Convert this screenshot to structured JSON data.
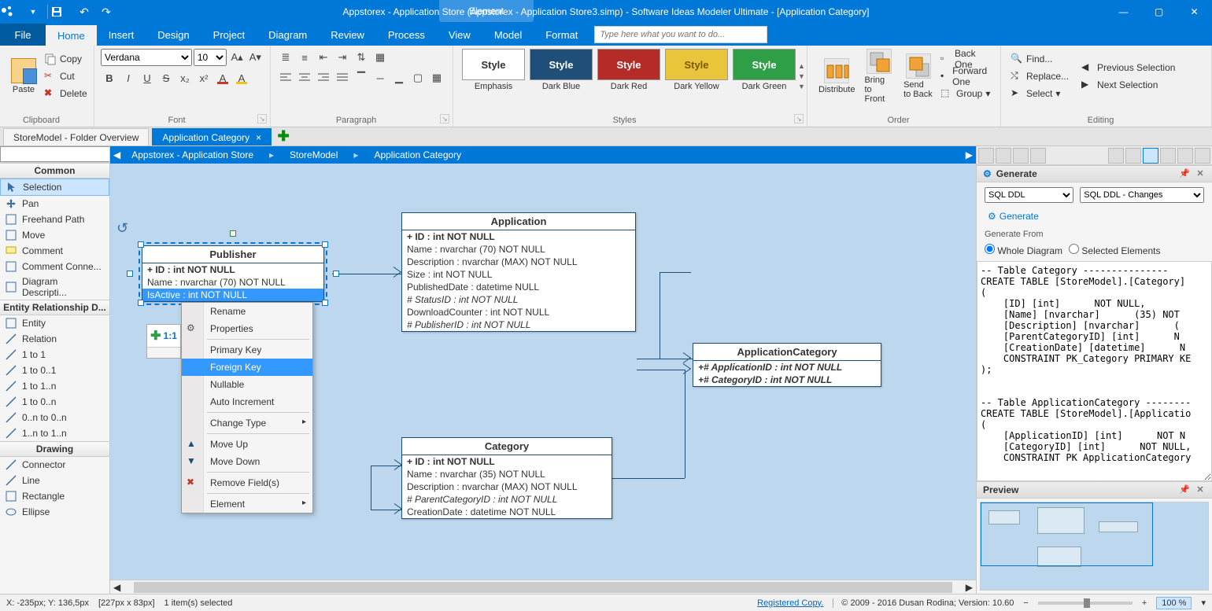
{
  "titlebar": {
    "element_tag": "Element",
    "title": "Appstorex - Application Store (Appstorex - Application Store3.simp)  - Software Ideas Modeler Ultimate - [Application Category]"
  },
  "menubar": {
    "file": "File",
    "tabs": [
      "Home",
      "Insert",
      "Design",
      "Project",
      "Diagram",
      "Review",
      "Process",
      "View",
      "Model",
      "Format"
    ],
    "active": 0,
    "search_placeholder": "Type here what you want to do..."
  },
  "ribbon": {
    "clipboard": {
      "label": "Clipboard",
      "paste": "Paste",
      "copy": "Copy",
      "cut": "Cut",
      "delete": "Delete"
    },
    "font": {
      "label": "Font",
      "name": "Verdana",
      "size": "10"
    },
    "paragraph": {
      "label": "Paragraph"
    },
    "styles": {
      "label": "Styles",
      "items": [
        {
          "text": "Style",
          "bg": "#ffffff",
          "fg": "#333333",
          "sub": "Emphasis"
        },
        {
          "text": "Style",
          "bg": "#1f4e79",
          "fg": "#ffffff",
          "sub": "Dark Blue"
        },
        {
          "text": "Style",
          "bg": "#b52b27",
          "fg": "#ffffff",
          "sub": "Dark Red"
        },
        {
          "text": "Style",
          "bg": "#e8c53a",
          "fg": "#7a5900",
          "sub": "Dark Yellow"
        },
        {
          "text": "Style",
          "bg": "#2e9e47",
          "fg": "#ffffff",
          "sub": "Dark Green"
        }
      ]
    },
    "order": {
      "label": "Order",
      "distribute": "Distribute",
      "bring_front": "Bring to Front",
      "send_back": "Send to Back",
      "back_one": "Back One",
      "forward_one": "Forward One",
      "group": "Group"
    },
    "editing": {
      "label": "Editing",
      "find": "Find...",
      "replace": "Replace...",
      "select": "Select",
      "prev_sel": "Previous Selection",
      "next_sel": "Next Selection"
    }
  },
  "doctabs": {
    "tabs": [
      {
        "label": "StoreModel - Folder Overview",
        "active": false
      },
      {
        "label": "Application Category",
        "active": true
      }
    ]
  },
  "toolbox": {
    "categories": [
      {
        "title": "Common",
        "tools": [
          {
            "label": "Selection",
            "sel": true,
            "icon": "cursor"
          },
          {
            "label": "Pan",
            "icon": "pan"
          },
          {
            "label": "Freehand Path",
            "icon": "path"
          },
          {
            "label": "Move",
            "icon": "move"
          },
          {
            "label": "Comment",
            "icon": "comment"
          },
          {
            "label": "Comment Conne...",
            "icon": "comment-conn"
          },
          {
            "label": "Diagram Descripti...",
            "icon": "desc"
          }
        ]
      },
      {
        "title": "Entity Relationship D...",
        "tools": [
          {
            "label": "Entity",
            "icon": "entity"
          },
          {
            "label": "Relation",
            "icon": "relation"
          },
          {
            "label": "1 to 1",
            "icon": "rel"
          },
          {
            "label": "1 to 0..1",
            "icon": "rel"
          },
          {
            "label": "1 to 1..n",
            "icon": "rel"
          },
          {
            "label": "1 to 0..n",
            "icon": "rel"
          },
          {
            "label": "0..n to 0..n",
            "icon": "rel"
          },
          {
            "label": "1..n to 1..n",
            "icon": "rel"
          }
        ]
      },
      {
        "title": "Drawing",
        "tools": [
          {
            "label": "Connector",
            "icon": "line"
          },
          {
            "label": "Line",
            "icon": "line"
          },
          {
            "label": "Rectangle",
            "icon": "rect"
          },
          {
            "label": "Ellipse",
            "icon": "ellipse"
          }
        ]
      }
    ]
  },
  "breadcrumb": {
    "items": [
      "Appstorex - Application Store",
      "StoreModel",
      "Application Category"
    ]
  },
  "entities": {
    "publisher": {
      "title": "Publisher",
      "rows": [
        {
          "text": "+ ID : int NOT NULL",
          "pk": true
        },
        {
          "text": "Name : nvarchar (70)  NOT NULL"
        },
        {
          "text": "IsActive : int NOT NULL",
          "hi": true
        }
      ]
    },
    "application": {
      "title": "Application",
      "rows": [
        {
          "text": "+ ID : int NOT NULL",
          "pk": true
        },
        {
          "text": "Name : nvarchar (70)  NOT NULL"
        },
        {
          "text": "Description : nvarchar (MAX)  NOT NULL"
        },
        {
          "text": "Size : int NOT NULL"
        },
        {
          "text": "PublishedDate : datetime NULL"
        },
        {
          "text": "# StatusID : int NOT NULL",
          "fk": true
        },
        {
          "text": "DownloadCounter : int NOT NULL"
        },
        {
          "text": "# PublisherID : int NOT NULL",
          "fk": true
        }
      ]
    },
    "appcat": {
      "title": "ApplicationCategory",
      "rows": [
        {
          "text": "+# ApplicationID : int NOT NULL",
          "pk": true,
          "fk": true
        },
        {
          "text": "+# CategoryID : int NOT NULL",
          "pk": true,
          "fk": true
        }
      ]
    },
    "category": {
      "title": "Category",
      "rows": [
        {
          "text": "+ ID : int NOT NULL",
          "pk": true
        },
        {
          "text": "Name : nvarchar (35)  NOT NULL"
        },
        {
          "text": "Description : nvarchar (MAX)  NOT NULL"
        },
        {
          "text": "# ParentCategoryID : int NOT NULL",
          "fk": true
        },
        {
          "text": "CreationDate : datetime NOT NULL"
        }
      ]
    }
  },
  "context_menu": {
    "items": [
      {
        "label": "Rename"
      },
      {
        "label": "Properties",
        "icon": "props"
      },
      {
        "sep": true
      },
      {
        "label": "Primary Key"
      },
      {
        "label": "Foreign Key",
        "hi": true
      },
      {
        "label": "Nullable"
      },
      {
        "label": "Auto Increment"
      },
      {
        "sep": true
      },
      {
        "label": "Change Type",
        "sub": true
      },
      {
        "sep": true
      },
      {
        "label": "Move Up",
        "icon": "up"
      },
      {
        "label": "Move Down",
        "icon": "down"
      },
      {
        "sep": true
      },
      {
        "label": "Remove Field(s)",
        "icon": "remove"
      },
      {
        "sep": true
      },
      {
        "label": "Element",
        "sub": true
      }
    ]
  },
  "mini_box": "1:1",
  "right": {
    "generate_hdr": "Generate",
    "dd1": "SQL DDL",
    "dd2": "SQL DDL - Changes",
    "generate_btn": "Generate",
    "from_label": "Generate From",
    "opt_whole": "Whole Diagram",
    "opt_sel": "Selected Elements",
    "code": "-- Table Category ---------------\nCREATE TABLE [StoreModel].[Category]\n(\n    [ID] [int]      NOT NULL,\n    [Name] [nvarchar]      (35) NOT\n    [Description] [nvarchar]      (\n    [ParentCategoryID] [int]      N\n    [CreationDate] [datetime]      N\n    CONSTRAINT PK_Category PRIMARY KE\n);\n\n\n-- Table ApplicationCategory --------\nCREATE TABLE [StoreModel].[Applicatio\n(\n    [ApplicationID] [int]      NOT N\n    [CategoryID] [int]      NOT NULL,\n    CONSTRAINT PK ApplicationCategory",
    "preview_hdr": "Preview"
  },
  "status": {
    "coords": "X: -235px; Y: 136,5px",
    "size": "[227px x 83px]",
    "sel": "1 item(s) selected",
    "reg": "Registered Copy.",
    "copyright": "© 2009 - 2016 Dusan Rodina; Version: 10.60",
    "zoom": "100 %"
  }
}
